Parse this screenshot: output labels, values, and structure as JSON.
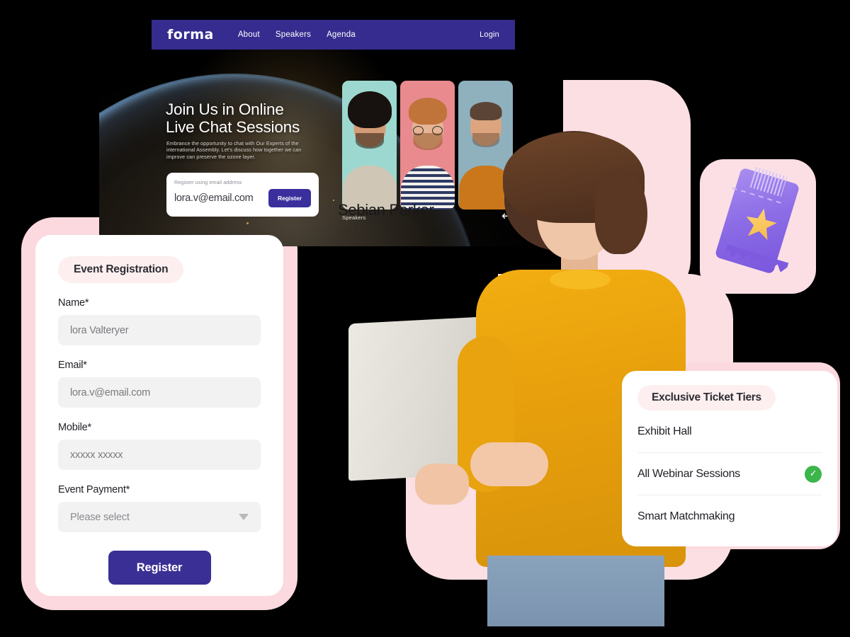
{
  "navbar": {
    "logo": "forma",
    "links": [
      {
        "label": "About"
      },
      {
        "label": "Speakers"
      },
      {
        "label": "Agenda"
      }
    ],
    "login_label": "Login",
    "background_color": "#362c8f"
  },
  "hero": {
    "title_line1": "Join Us in Online",
    "title_line2": "Live Chat Sessions",
    "subtitle": "Embrance the opportunity to chat with Our Experts of the international  Assembly. Let's discuss how together we can improve can preserve the ozone layer.",
    "signup": {
      "label": "Register using email address",
      "email_value": "lora.v@email.com",
      "button_label": "Register",
      "button_color": "#3a2f9c"
    },
    "speakers_label": "Speakers",
    "speaker_ghost_name": "Sebian Parker",
    "carousel": {
      "prev": "←",
      "next": "→"
    },
    "speaker_cards": [
      {
        "bg_color": "#9cd8cf"
      },
      {
        "bg_color": "#e98a8e"
      },
      {
        "bg_color": "#8fb0bd"
      }
    ]
  },
  "registration_form": {
    "badge": "Event Registration",
    "fields": [
      {
        "label": "Name*",
        "value": "lora Valteryer",
        "type": "text"
      },
      {
        "label": "Email*",
        "value": "lora.v@email.com",
        "type": "text"
      },
      {
        "label": "Mobile*",
        "value": "xxxxx xxxxx",
        "type": "text"
      },
      {
        "label": "Event Payment*",
        "value": "Please select",
        "type": "select"
      }
    ],
    "submit_label": "Register",
    "submit_color": "#3a2f94"
  },
  "ticket_tiers": {
    "badge": "Exclusive Ticket Tiers",
    "items": [
      {
        "label": "Exhibit Hall",
        "checked": false
      },
      {
        "label": "All Webinar Sessions",
        "checked": true
      },
      {
        "label": "Smart Matchmaking",
        "checked": false
      }
    ],
    "check_glyph": "✓",
    "check_color": "#3cb54a"
  },
  "decor": {
    "pink": "#fbdfe3",
    "pink_deep": "#fbd9de",
    "background": "#000000"
  }
}
